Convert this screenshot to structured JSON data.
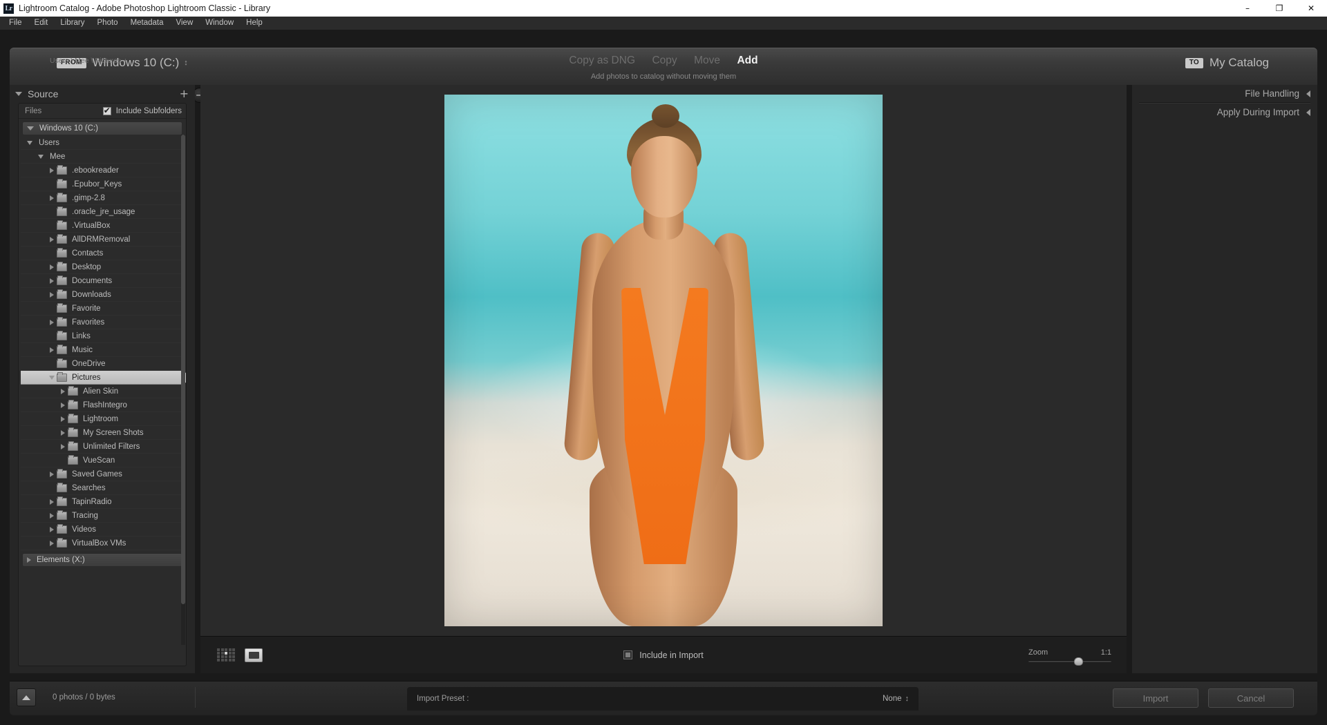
{
  "window": {
    "title": "Lightroom Catalog - Adobe Photoshop Lightroom Classic - Library",
    "logo_text": "Lr",
    "minimize": "–",
    "maximize": "❐",
    "close": "✕"
  },
  "menubar": {
    "items": [
      "File",
      "Edit",
      "Library",
      "Photo",
      "Metadata",
      "View",
      "Window",
      "Help"
    ]
  },
  "importbar": {
    "from_tag": "FROM",
    "source_name": "Windows 10 (C:)",
    "stepper": "↕",
    "breadcrumb": "Users \\ Mee \\ Pictures +",
    "arrow_left": "→",
    "arrow_right": "→",
    "to_tag": "TO",
    "destination_name": "My Catalog",
    "modes": [
      {
        "label": "Copy as DNG",
        "active": false
      },
      {
        "label": "Copy",
        "active": false
      },
      {
        "label": "Move",
        "active": false
      },
      {
        "label": "Add",
        "active": true
      }
    ],
    "mode_description": "Add photos to catalog without moving them"
  },
  "source_panel": {
    "title": "Source",
    "plus_icon": "+",
    "files_label": "Files",
    "include_subfolders_label": "Include Subfolders",
    "include_subfolders_checked": true,
    "drive_top": "Windows 10 (C:)",
    "drive_bottom": "Elements (X:)",
    "tree": [
      {
        "label": "Users",
        "indent": 0,
        "twisty": "down",
        "folder": false,
        "selected": false
      },
      {
        "label": "Mee",
        "indent": 1,
        "twisty": "down",
        "folder": false,
        "selected": false
      },
      {
        "label": ".ebookreader",
        "indent": 2,
        "twisty": "right",
        "folder": true,
        "selected": false
      },
      {
        "label": ".Epubor_Keys",
        "indent": 2,
        "twisty": "none",
        "folder": true,
        "selected": false
      },
      {
        "label": ".gimp-2.8",
        "indent": 2,
        "twisty": "right",
        "folder": true,
        "selected": false
      },
      {
        "label": ".oracle_jre_usage",
        "indent": 2,
        "twisty": "none",
        "folder": true,
        "selected": false
      },
      {
        "label": ".VirtualBox",
        "indent": 2,
        "twisty": "none",
        "folder": true,
        "selected": false
      },
      {
        "label": "AllDRMRemoval",
        "indent": 2,
        "twisty": "right",
        "folder": true,
        "selected": false
      },
      {
        "label": "Contacts",
        "indent": 2,
        "twisty": "none",
        "folder": true,
        "selected": false
      },
      {
        "label": "Desktop",
        "indent": 2,
        "twisty": "right",
        "folder": true,
        "selected": false
      },
      {
        "label": "Documents",
        "indent": 2,
        "twisty": "right",
        "folder": true,
        "selected": false
      },
      {
        "label": "Downloads",
        "indent": 2,
        "twisty": "right",
        "folder": true,
        "selected": false
      },
      {
        "label": "Favorite",
        "indent": 2,
        "twisty": "none",
        "folder": true,
        "selected": false
      },
      {
        "label": "Favorites",
        "indent": 2,
        "twisty": "right",
        "folder": true,
        "selected": false
      },
      {
        "label": "Links",
        "indent": 2,
        "twisty": "none",
        "folder": true,
        "selected": false
      },
      {
        "label": "Music",
        "indent": 2,
        "twisty": "right",
        "folder": true,
        "selected": false
      },
      {
        "label": "OneDrive",
        "indent": 2,
        "twisty": "none",
        "folder": true,
        "selected": false
      },
      {
        "label": "Pictures",
        "indent": 2,
        "twisty": "hollow",
        "folder": true,
        "selected": true
      },
      {
        "label": "Alien Skin",
        "indent": 3,
        "twisty": "right",
        "folder": true,
        "selected": false
      },
      {
        "label": "FlashIntegro",
        "indent": 3,
        "twisty": "right",
        "folder": true,
        "selected": false
      },
      {
        "label": "Lightroom",
        "indent": 3,
        "twisty": "right",
        "folder": true,
        "selected": false
      },
      {
        "label": "My Screen Shots",
        "indent": 3,
        "twisty": "right",
        "folder": true,
        "selected": false
      },
      {
        "label": "Unlimited Filters",
        "indent": 3,
        "twisty": "right",
        "folder": true,
        "selected": false
      },
      {
        "label": "VueScan",
        "indent": 3,
        "twisty": "none",
        "folder": true,
        "selected": false
      },
      {
        "label": "Saved Games",
        "indent": 2,
        "twisty": "right",
        "folder": true,
        "selected": false
      },
      {
        "label": "Searches",
        "indent": 2,
        "twisty": "none",
        "folder": true,
        "selected": false
      },
      {
        "label": "TapinRadio",
        "indent": 2,
        "twisty": "right",
        "folder": true,
        "selected": false
      },
      {
        "label": "Tracing",
        "indent": 2,
        "twisty": "right",
        "folder": true,
        "selected": false
      },
      {
        "label": "Videos",
        "indent": 2,
        "twisty": "right",
        "folder": true,
        "selected": false
      },
      {
        "label": "VirtualBox VMs",
        "indent": 2,
        "twisty": "right",
        "folder": true,
        "selected": false
      }
    ]
  },
  "right_panel": {
    "sections": [
      {
        "title": "File Handling"
      },
      {
        "title": "Apply During Import"
      }
    ]
  },
  "toolbar": {
    "grid_view_icon": "grid-view-icon",
    "loupe_view_icon": "loupe-view-icon",
    "include_in_import_label": "Include in Import",
    "include_in_import_checked": false,
    "zoom_label": "Zoom",
    "zoom_value": "1:1"
  },
  "bottombar": {
    "collapse_icon": "▲",
    "photo_count": "0 photos / 0 bytes",
    "preset_label": "Import Preset :",
    "preset_value": "None",
    "preset_stepper": "↕",
    "import_button": "Import",
    "cancel_button": "Cancel"
  },
  "colors": {
    "accent_orange": "#f47a1f",
    "panel_bg": "#262626",
    "app_bg": "#1a1a1a",
    "text_primary": "#bdbdbd"
  }
}
